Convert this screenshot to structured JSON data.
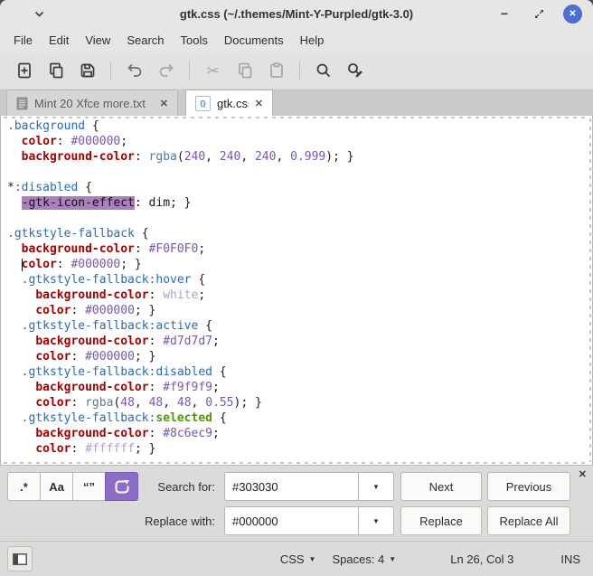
{
  "window": {
    "title": "gtk.css (~/.themes/Mint-Y-Purpled/gtk-3.0)"
  },
  "menubar": {
    "items": [
      "File",
      "Edit",
      "View",
      "Search",
      "Tools",
      "Documents",
      "Help"
    ]
  },
  "toolbar": {
    "icons": [
      "new-document",
      "open-document",
      "save",
      "undo",
      "redo",
      "cut",
      "copy",
      "paste",
      "find",
      "find-and-replace"
    ]
  },
  "tabs": [
    {
      "label": "Mint 20 Xfce more.txt",
      "active": false
    },
    {
      "label": "gtk.css",
      "active": true,
      "icon_glyph": "{}"
    }
  ],
  "icons": {
    "minimize": "−",
    "window_close": "✕",
    "tab_close": "✕",
    "panel_close": "✕",
    "dropdown": "▼",
    "scissors": "✂"
  },
  "editor": {
    "lines": [
      [
        {
          "c": "s",
          "t": ".background"
        },
        {
          "c": "p",
          "t": " {"
        }
      ],
      [
        {
          "c": "p",
          "t": "  "
        },
        {
          "c": "k",
          "t": "color"
        },
        {
          "c": "p",
          "t": ": "
        },
        {
          "c": "v",
          "t": "#000000"
        },
        {
          "c": "p",
          "t": ";"
        }
      ],
      [
        {
          "c": "p",
          "t": "  "
        },
        {
          "c": "k",
          "t": "background-color"
        },
        {
          "c": "p",
          "t": ": "
        },
        {
          "c": "f",
          "t": "rgba"
        },
        {
          "c": "p",
          "t": "("
        },
        {
          "c": "v",
          "t": "240"
        },
        {
          "c": "p",
          "t": ", "
        },
        {
          "c": "v",
          "t": "240"
        },
        {
          "c": "p",
          "t": ", "
        },
        {
          "c": "v",
          "t": "240"
        },
        {
          "c": "p",
          "t": ", "
        },
        {
          "c": "v",
          "t": "0.999"
        },
        {
          "c": "p",
          "t": "); }"
        }
      ],
      [],
      [
        {
          "c": "p",
          "t": "*"
        },
        {
          "c": "s",
          "t": ":disabled"
        },
        {
          "c": "p",
          "t": " {"
        }
      ],
      [
        {
          "c": "p",
          "t": "  "
        },
        {
          "c": "h",
          "t": "-gtk-icon-effect"
        },
        {
          "c": "p",
          "t": ": dim; }"
        }
      ],
      [],
      [
        {
          "c": "s",
          "t": ".gtkstyle-fallback"
        },
        {
          "c": "p",
          "t": " {"
        }
      ],
      [
        {
          "c": "p",
          "t": "  "
        },
        {
          "c": "k",
          "t": "background-color"
        },
        {
          "c": "p",
          "t": ": "
        },
        {
          "c": "v",
          "t": "#F0F0F0"
        },
        {
          "c": "p",
          "t": ";"
        }
      ],
      [
        {
          "c": "p",
          "t": "  "
        },
        {
          "c": "c",
          "t": ""
        },
        {
          "c": "k",
          "t": "color"
        },
        {
          "c": "p",
          "t": ": "
        },
        {
          "c": "v",
          "t": "#000000"
        },
        {
          "c": "p",
          "t": "; }"
        }
      ],
      [
        {
          "c": "p",
          "t": "  "
        },
        {
          "c": "s",
          "t": ".gtkstyle-fallback:hover"
        },
        {
          "c": "p",
          "t": " {"
        }
      ],
      [
        {
          "c": "p",
          "t": "    "
        },
        {
          "c": "k",
          "t": "background-color"
        },
        {
          "c": "p",
          "t": ": "
        },
        {
          "c": "w",
          "t": "white"
        },
        {
          "c": "p",
          "t": ";"
        }
      ],
      [
        {
          "c": "p",
          "t": "    "
        },
        {
          "c": "k",
          "t": "color"
        },
        {
          "c": "p",
          "t": ": "
        },
        {
          "c": "v",
          "t": "#000000"
        },
        {
          "c": "p",
          "t": "; }"
        }
      ],
      [
        {
          "c": "p",
          "t": "  "
        },
        {
          "c": "s",
          "t": ".gtkstyle-fallback:active"
        },
        {
          "c": "p",
          "t": " {"
        }
      ],
      [
        {
          "c": "p",
          "t": "    "
        },
        {
          "c": "k",
          "t": "background-color"
        },
        {
          "c": "p",
          "t": ": "
        },
        {
          "c": "v",
          "t": "#d7d7d7"
        },
        {
          "c": "p",
          "t": ";"
        }
      ],
      [
        {
          "c": "p",
          "t": "    "
        },
        {
          "c": "k",
          "t": "color"
        },
        {
          "c": "p",
          "t": ": "
        },
        {
          "c": "v",
          "t": "#000000"
        },
        {
          "c": "p",
          "t": "; }"
        }
      ],
      [
        {
          "c": "p",
          "t": "  "
        },
        {
          "c": "s",
          "t": ".gtkstyle-fallback:disabled"
        },
        {
          "c": "p",
          "t": " {"
        }
      ],
      [
        {
          "c": "p",
          "t": "    "
        },
        {
          "c": "k",
          "t": "background-color"
        },
        {
          "c": "p",
          "t": ": "
        },
        {
          "c": "v",
          "t": "#f9f9f9"
        },
        {
          "c": "p",
          "t": ";"
        }
      ],
      [
        {
          "c": "p",
          "t": "    "
        },
        {
          "c": "k",
          "t": "color"
        },
        {
          "c": "p",
          "t": ": "
        },
        {
          "c": "f",
          "t": "rgba"
        },
        {
          "c": "p",
          "t": "("
        },
        {
          "c": "v",
          "t": "48"
        },
        {
          "c": "p",
          "t": ", "
        },
        {
          "c": "v",
          "t": "48"
        },
        {
          "c": "p",
          "t": ", "
        },
        {
          "c": "v",
          "t": "48"
        },
        {
          "c": "p",
          "t": ", "
        },
        {
          "c": "v",
          "t": "0.55"
        },
        {
          "c": "p",
          "t": "); }"
        }
      ],
      [
        {
          "c": "p",
          "t": "  "
        },
        {
          "c": "s",
          "t": ".gtkstyle-fallback:"
        },
        {
          "c": "g",
          "t": "selected"
        },
        {
          "c": "p",
          "t": " {"
        }
      ],
      [
        {
          "c": "p",
          "t": "    "
        },
        {
          "c": "k",
          "t": "background-color"
        },
        {
          "c": "p",
          "t": ": "
        },
        {
          "c": "v",
          "t": "#8c6ec9"
        },
        {
          "c": "p",
          "t": ";"
        }
      ],
      [
        {
          "c": "p",
          "t": "    "
        },
        {
          "c": "k",
          "t": "color"
        },
        {
          "c": "p",
          "t": ": "
        },
        {
          "c": "w",
          "t": "#ffffff"
        },
        {
          "c": "p",
          "t": "; }"
        }
      ]
    ]
  },
  "search": {
    "toggles": {
      "regex": ".*",
      "case": "Aa",
      "quotes": "“”"
    },
    "search_label": "Search for:",
    "search_value": "#303030",
    "next": "Next",
    "previous": "Previous",
    "replace_label": "Replace with:",
    "replace_value": "#000000",
    "replace": "Replace",
    "replace_all": "Replace All"
  },
  "statusbar": {
    "language": "CSS",
    "spaces": "Spaces: 4",
    "position": "Ln 26, Col 3",
    "mode": "INS"
  },
  "colors": {
    "accent": "#8c6ec9",
    "match_highlight": "#aa80bd",
    "close_button": "#4d6fd2",
    "selector_blue": "#2a69bd",
    "property_red": "#a40000",
    "value_violet": "#7a55b4",
    "selected_green": "#4e9a06"
  }
}
